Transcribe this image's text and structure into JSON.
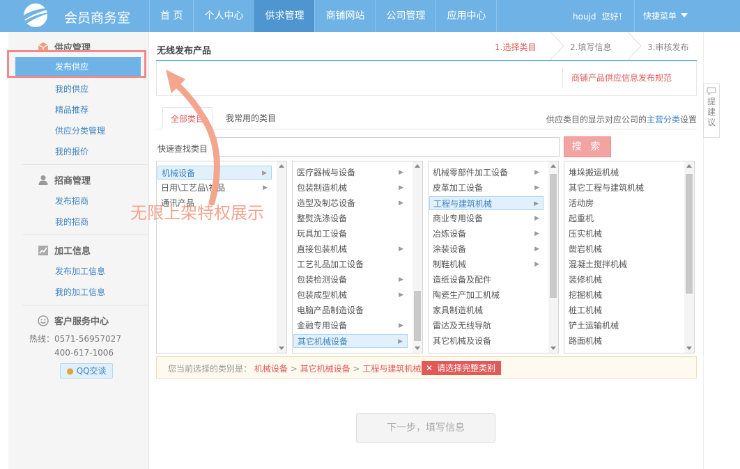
{
  "header": {
    "app_title": "会员商务室",
    "nav": [
      "首 页",
      "个人中心",
      "供求管理",
      "商铺网站",
      "公司管理",
      "应用中心"
    ],
    "active_nav_index": 2,
    "username": "houjd",
    "greeting": "您好！",
    "quick_menu": "快捷菜单"
  },
  "sidebar": {
    "supply": {
      "title": "供应管理",
      "items": [
        "发布供应",
        "我的供应",
        "精品推荐",
        "供应分类管理",
        "我的报价"
      ]
    },
    "invest": {
      "title": "招商管理",
      "items": [
        "发布招商",
        "我的招商"
      ]
    },
    "process": {
      "title": "加工信息",
      "items": [
        "发布加工信息",
        "我的加工信息"
      ]
    },
    "service": {
      "title": "客户服务中心",
      "hotline": "热线：0571-56957027",
      "phone2": "400-617-1006",
      "qq_button": "QQ交谈"
    }
  },
  "main": {
    "title": "无线发布产品",
    "steps": [
      "1.选择类目",
      "2.填写信息",
      "3.审核发布"
    ],
    "rule_link": "商铺产品供应信息发布规范",
    "tabs": [
      "全部类目",
      "我常用的类目"
    ],
    "tab_note_prefix": "供应类目的显示对应公司的",
    "tab_note_link": "主营分类",
    "tab_note_suffix": "设置",
    "search_label": "快速查找类目",
    "search_value": "",
    "search_button": "搜 索",
    "columns": [
      [
        "机械设备",
        "日用\\工艺品\\礼品",
        "通讯产品"
      ],
      [
        "医疗器械与设备",
        "包装制造机械",
        "造型及制芯设备",
        "整熨洗涤设备",
        "玩具加工设备",
        "直接包装机械",
        "工艺礼品加工设备",
        "包装检测设备",
        "包装成型机械",
        "电脑产品制造设备",
        "金融专用设备",
        "其它机械设备"
      ],
      [
        "机械零部件加工设备",
        "皮革加工设备",
        "工程与建筑机械",
        "商业专用设备",
        "冶炼设备",
        "涂装设备",
        "制鞋机械",
        "造纸设备及配件",
        "陶瓷生产加工机械",
        "家具制造机械",
        "雷达及无线导航",
        "其它机械及设备"
      ],
      [
        "堆垛搬运机械",
        "其它工程与建筑机械",
        "活动房",
        "起重机",
        "压实机械",
        "凿岩机械",
        "混凝土搅拌机械",
        "装修机械",
        "挖掘机械",
        "桩工机械",
        "铲土运输机械",
        "路面机械"
      ]
    ],
    "path_prefix": "您当前选择的类别是：",
    "path": [
      "机械设备",
      "其它机械设备",
      "工程与建筑机械"
    ],
    "path_sep": ">",
    "path_warning": "请选择完整类别",
    "next_button": "下一步，填写信息",
    "annotation": "无限上架特权展示"
  },
  "suggest": "提建议",
  "colors": {
    "brand": "#6fb3e6",
    "nav_active": "#4f96d0",
    "accent_red": "#e05a5a",
    "link_blue": "#3f84c2"
  }
}
